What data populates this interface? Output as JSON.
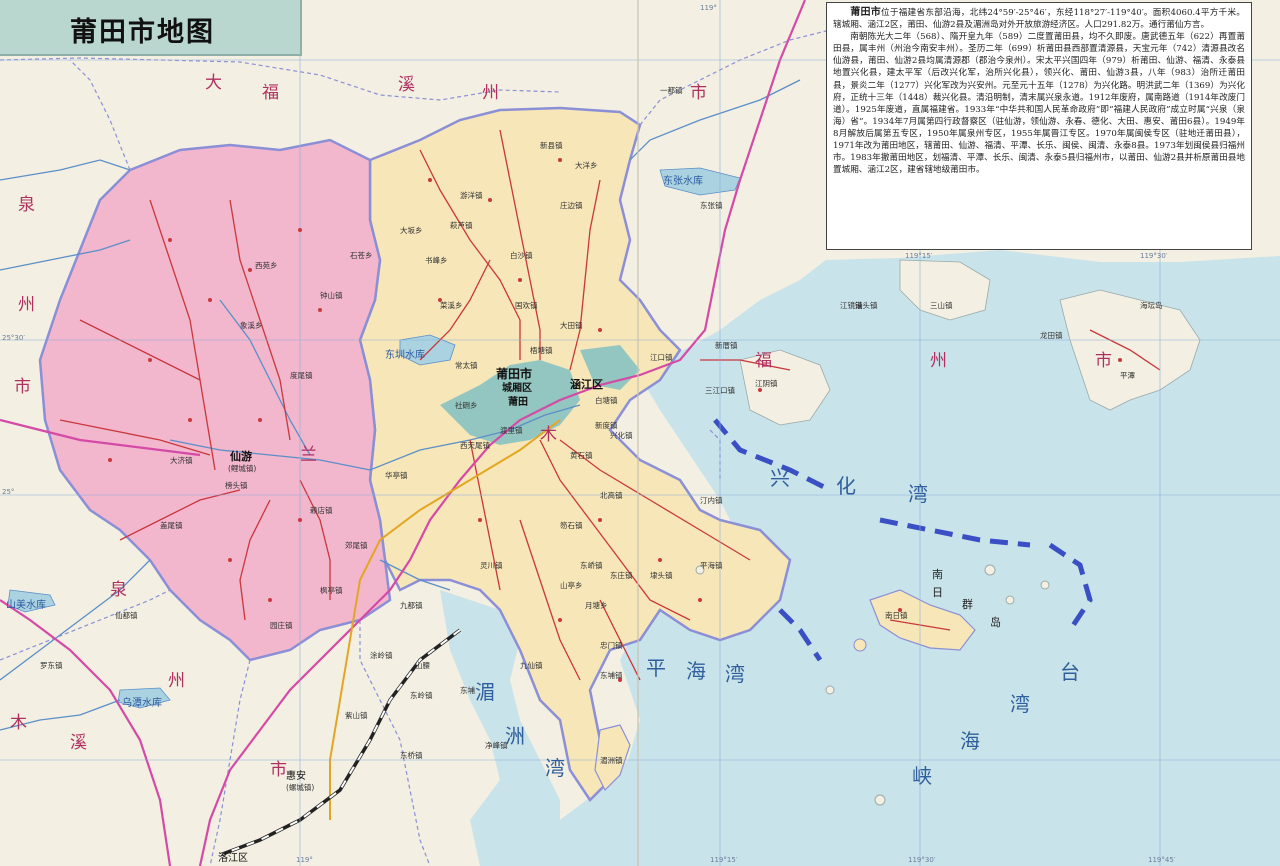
{
  "title": "莆田市地图",
  "info": {
    "lead_name": "莆田市",
    "para1": "位于福建省东部沿海，北纬24°59′-25°46′，东经118°27′-119°40′。面积4060.4平方千米。辖城厢、涵江2区，莆田、仙游2县及湄洲岛对外开放旅游经济区。人口291.82万。通行莆仙方言。",
    "para2": "南朝陈光大二年（568）、隋开皇九年（589）二度置莆田县，均不久即废。唐武德五年（622）再置莆田县，属丰州（州治今南安丰州）。圣历二年（699）析莆田县西部置清源县，天宝元年（742）清源县改名仙游县，莆田、仙游2县均属清源郡（郡治今泉州）。宋太平兴国四年（979）析莆田、仙游、福清、永泰县地置兴化县，建太平军（后改兴化军，治所兴化县），领兴化、莆田、仙游3县，八年（983）治所迁莆田县，景炎二年（1277）兴化军改为兴安州。元至元十五年（1278）为兴化路。明洪武二年（1369）为兴化府，正统十三年（1448）裁兴化县。清沿明制，清末属兴泉永道。1912年废府，属南路道（1914年改废门道）。1925年废道，直属福建省。1933年“中华共和国人民革命政府”即“福建人民政府”成立时属“兴泉（泉海）省”。1934年7月属第四行政督察区（驻仙游，领仙游、永春、德化、大田、惠安、莆田6县）。1949年8月解放后属第五专区，1950年属泉州专区，1955年属晋江专区。1970年属闽侯专区（驻地迁莆田县），1971年改为莆田地区，辖莆田、仙游、福清、平潭、长乐、闽侯、闽清、永泰8县。1973年划闽侯县归福州市。1983年撤莆田地区，划福清、平潭、长乐、闽清、永泰5县归福州市，以莆田、仙游2县并析原莆田县地置城厢、涵江2区，建省辖地级莆田市。"
  },
  "regions": {
    "fuzhou_1": "福",
    "fuzhou_2": "州",
    "fuzhou_3": "市",
    "quanzhou_1": "泉",
    "quanzhou_2": "州",
    "quanzhou_3": "市",
    "quanzhou_b1": "泉",
    "quanzhou_b2": "州",
    "quanzhou_b3": "市",
    "fuzhou_e1": "福",
    "fuzhou_e2": "州",
    "fuzhou_e3": "市",
    "fuzhou_n1": "福",
    "fuzhou_n2": "州",
    "fuzhou_n3": "市",
    "da": "大",
    "fuxi": "溪",
    "mu": "木",
    "lan": "兰",
    "xi2": "溪",
    "mu2": "木"
  },
  "seas": {
    "xinghua1": "兴",
    "xinghua2": "化",
    "wan1": "湾",
    "pinghai1": "平",
    "pinghai2": "海",
    "wan2": "湾",
    "mei1": "湄",
    "zhou1": "洲",
    "wan3": "湾",
    "tai": "台",
    "wan4": "湾",
    "hai": "海",
    "xia": "峡",
    "nanri1": "南",
    "nanri2": "日",
    "qun": "群",
    "dao": "岛"
  },
  "cities": {
    "putian": "莆田市",
    "chengxiang": "城厢区",
    "putian_seat": "莆田",
    "hanjiang": "涵江区",
    "xianyou": "仙游",
    "xianyou_sub": "(鲤城镇)",
    "huian": "惠安",
    "huian_sub": "(螺城镇)",
    "luojiang": "洛江区"
  },
  "water": {
    "dongzhen": "东圳水库",
    "shanmei": "山美水库",
    "wuyao": "乌潭水库",
    "dongzhang": "东张水库"
  },
  "towns": [
    {
      "name": "庄边镇"
    },
    {
      "name": "大洋乡"
    },
    {
      "name": "新县镇"
    },
    {
      "name": "白沙镇"
    },
    {
      "name": "游洋镇"
    },
    {
      "name": "钟山镇"
    },
    {
      "name": "石苍乡"
    },
    {
      "name": "象溪乡"
    },
    {
      "name": "西苑乡"
    },
    {
      "name": "度尾镇"
    },
    {
      "name": "大济镇"
    },
    {
      "name": "榜头镇"
    },
    {
      "name": "赖店镇"
    },
    {
      "name": "郊尾镇"
    },
    {
      "name": "枫亭镇"
    },
    {
      "name": "园庄镇"
    },
    {
      "name": "盖尾镇"
    },
    {
      "name": "书峰乡"
    },
    {
      "name": "社硎乡"
    },
    {
      "name": "菜溪乡"
    },
    {
      "name": "常太镇"
    },
    {
      "name": "华亭镇"
    },
    {
      "name": "西天尾镇"
    },
    {
      "name": "黄石镇"
    },
    {
      "name": "北高镇"
    },
    {
      "name": "笏石镇"
    },
    {
      "name": "东峤镇"
    },
    {
      "name": "平海镇"
    },
    {
      "name": "埭头镇"
    },
    {
      "name": "东庄镇"
    },
    {
      "name": "忠门镇"
    },
    {
      "name": "山亭乡"
    },
    {
      "name": "月塘乡"
    },
    {
      "name": "东埔镇"
    },
    {
      "name": "灵川镇"
    },
    {
      "name": "江口镇"
    },
    {
      "name": "新度镇"
    },
    {
      "name": "萩芦镇"
    },
    {
      "name": "梧塘镇"
    },
    {
      "name": "白塘镇"
    },
    {
      "name": "渡里镇"
    },
    {
      "name": "三江口镇"
    },
    {
      "name": "国欢镇"
    },
    {
      "name": "南日镇"
    },
    {
      "name": "湄洲镇"
    },
    {
      "name": "新厝镇"
    },
    {
      "name": "江镜镇"
    },
    {
      "name": "三山镇"
    },
    {
      "name": "海坛岛"
    },
    {
      "name": "平潭"
    },
    {
      "name": "江阴镇"
    },
    {
      "name": "龙田镇"
    },
    {
      "name": "港头镇"
    },
    {
      "name": "东张镇"
    },
    {
      "name": "一都镇"
    },
    {
      "name": "大田镇"
    },
    {
      "name": "九都镇"
    },
    {
      "name": "涂岭镇"
    },
    {
      "name": "东岭镇"
    },
    {
      "name": "东桥镇"
    },
    {
      "name": "紫山镇"
    },
    {
      "name": "净峰镇"
    },
    {
      "name": "山腰"
    },
    {
      "name": "东埔"
    },
    {
      "name": "九仙镇"
    },
    {
      "name": "罗东镇"
    },
    {
      "name": "仙都镇"
    },
    {
      "name": "汀内镇"
    },
    {
      "name": "大坂乡"
    },
    {
      "name": "兴化镇"
    }
  ],
  "grid": {
    "lon_top_1": "119°",
    "lon_top_2": "119°15′",
    "lon_top_3": "119°30′",
    "lat_left_1": "25°",
    "lat_left_2": "25°30′",
    "lon_bot_1": "119°",
    "lon_bot_2": "119°15′",
    "lon_bot_3": "119°30′",
    "lon_bot_4": "119°45′"
  },
  "colors": {
    "xianyou_fill": "#f2b6cd",
    "licheng_fill": "#f7e6b8",
    "urban_fill": "#93c6c0",
    "sea": "#c9e3ea",
    "land_outside": "#f3efe2",
    "boundary": "#8b8fd6",
    "road_red": "#c9383c",
    "road_pink": "#d44aa6",
    "railway": "#222222"
  }
}
